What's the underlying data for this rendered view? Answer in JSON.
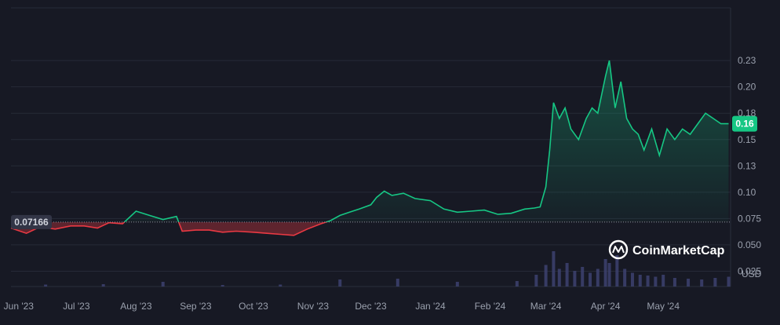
{
  "brand": "CoinMarketCap",
  "chart_data": {
    "type": "area",
    "currency": "USD",
    "baseline_value": 0.07166,
    "baseline_label": "0.07166",
    "current_value": 0.165,
    "current_label": "0.16",
    "ylim": [
      0.0,
      0.25
    ],
    "y_ticks": [
      {
        "value": 0.025,
        "label": "0.025"
      },
      {
        "value": 0.05,
        "label": "0.050"
      },
      {
        "value": 0.075,
        "label": "0.075"
      },
      {
        "value": 0.1,
        "label": "0.10"
      },
      {
        "value": 0.125,
        "label": "0.13"
      },
      {
        "value": 0.15,
        "label": "0.15"
      },
      {
        "value": 0.175,
        "label": "0.18"
      },
      {
        "value": 0.2,
        "label": "0.20"
      },
      {
        "value": 0.225,
        "label": "0.23"
      }
    ],
    "x_range": [
      "2023-05-28",
      "2024-06-05"
    ],
    "x_ticks": [
      {
        "date": "2023-06-01",
        "label": "Jun '23"
      },
      {
        "date": "2023-07-01",
        "label": "Jul '23"
      },
      {
        "date": "2023-08-01",
        "label": "Aug '23"
      },
      {
        "date": "2023-09-01",
        "label": "Sep '23"
      },
      {
        "date": "2023-10-01",
        "label": "Oct '23"
      },
      {
        "date": "2023-11-01",
        "label": "Nov '23"
      },
      {
        "date": "2023-12-01",
        "label": "Dec '23"
      },
      {
        "date": "2024-01-01",
        "label": "Jan '24"
      },
      {
        "date": "2024-02-01",
        "label": "Feb '24"
      },
      {
        "date": "2024-03-01",
        "label": "Mar '24"
      },
      {
        "date": "2024-04-01",
        "label": "Apr '24"
      },
      {
        "date": "2024-05-01",
        "label": "May '24"
      }
    ],
    "price_series": {
      "x": [
        "2023-05-28",
        "2023-06-05",
        "2023-06-12",
        "2023-06-20",
        "2023-06-28",
        "2023-07-05",
        "2023-07-12",
        "2023-07-18",
        "2023-07-25",
        "2023-08-01",
        "2023-08-08",
        "2023-08-15",
        "2023-08-22",
        "2023-08-25",
        "2023-09-01",
        "2023-09-08",
        "2023-09-15",
        "2023-09-22",
        "2023-10-01",
        "2023-10-08",
        "2023-10-15",
        "2023-10-22",
        "2023-10-29",
        "2023-11-05",
        "2023-11-10",
        "2023-11-15",
        "2023-11-20",
        "2023-11-25",
        "2023-12-01",
        "2023-12-04",
        "2023-12-08",
        "2023-12-12",
        "2023-12-18",
        "2023-12-24",
        "2024-01-01",
        "2024-01-08",
        "2024-01-15",
        "2024-01-22",
        "2024-01-29",
        "2024-02-05",
        "2024-02-12",
        "2024-02-19",
        "2024-02-24",
        "2024-02-27",
        "2024-03-01",
        "2024-03-03",
        "2024-03-05",
        "2024-03-08",
        "2024-03-11",
        "2024-03-14",
        "2024-03-18",
        "2024-03-22",
        "2024-03-25",
        "2024-03-28",
        "2024-04-01",
        "2024-04-03",
        "2024-04-06",
        "2024-04-09",
        "2024-04-12",
        "2024-04-15",
        "2024-04-18",
        "2024-04-21",
        "2024-04-25",
        "2024-04-29",
        "2024-05-03",
        "2024-05-07",
        "2024-05-11",
        "2024-05-15",
        "2024-05-19",
        "2024-05-23",
        "2024-05-27",
        "2024-05-31",
        "2024-06-04"
      ],
      "y": [
        0.066,
        0.061,
        0.067,
        0.065,
        0.068,
        0.068,
        0.066,
        0.071,
        0.07,
        0.082,
        0.078,
        0.074,
        0.077,
        0.063,
        0.064,
        0.064,
        0.062,
        0.063,
        0.062,
        0.061,
        0.06,
        0.059,
        0.065,
        0.07,
        0.073,
        0.078,
        0.081,
        0.084,
        0.088,
        0.095,
        0.101,
        0.097,
        0.099,
        0.094,
        0.092,
        0.084,
        0.081,
        0.082,
        0.083,
        0.079,
        0.08,
        0.084,
        0.085,
        0.086,
        0.105,
        0.14,
        0.185,
        0.17,
        0.18,
        0.16,
        0.15,
        0.17,
        0.18,
        0.175,
        0.21,
        0.225,
        0.18,
        0.205,
        0.17,
        0.16,
        0.155,
        0.14,
        0.16,
        0.135,
        0.16,
        0.15,
        0.16,
        0.155,
        0.165,
        0.175,
        0.17,
        0.165,
        0.165
      ]
    },
    "volume_series": {
      "unit": "USD",
      "x": [
        "2023-06",
        "2023-07",
        "2023-08",
        "2023-09",
        "2023-10",
        "2023-11",
        "2023-12",
        "2024-01",
        "2024-02",
        "2024-02-25",
        "2024-03-01",
        "2024-03-05",
        "2024-03-08",
        "2024-03-12",
        "2024-03-16",
        "2024-03-20",
        "2024-03-24",
        "2024-03-28",
        "2024-04-01",
        "2024-04-03",
        "2024-04-07",
        "2024-04-11",
        "2024-04-15",
        "2024-04-19",
        "2024-04-23",
        "2024-04-27",
        "2024-05-01",
        "2024-05-07",
        "2024-05-14",
        "2024-05-21",
        "2024-05-28",
        "2024-06-04"
      ],
      "relative_height": [
        0.05,
        0.06,
        0.12,
        0.04,
        0.05,
        0.18,
        0.2,
        0.12,
        0.14,
        0.3,
        0.55,
        0.9,
        0.45,
        0.6,
        0.4,
        0.5,
        0.35,
        0.45,
        0.7,
        0.6,
        0.8,
        0.45,
        0.35,
        0.3,
        0.28,
        0.25,
        0.3,
        0.22,
        0.2,
        0.18,
        0.22,
        0.25
      ]
    }
  }
}
